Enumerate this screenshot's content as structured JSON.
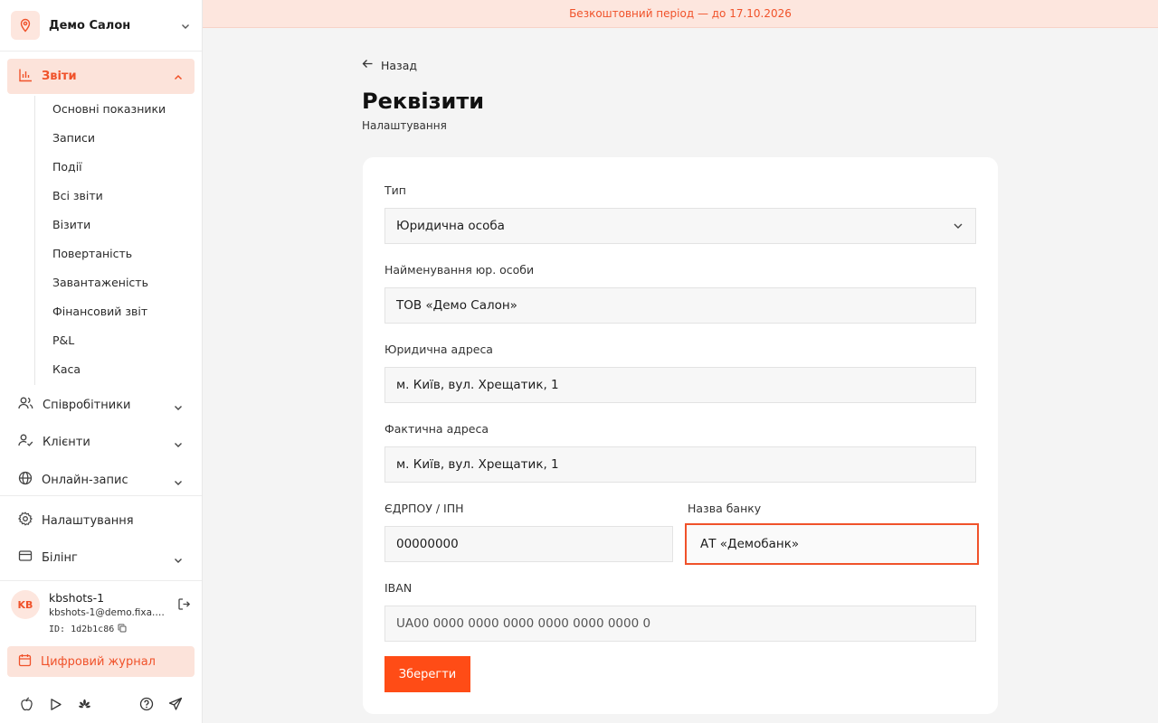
{
  "salon": {
    "name": "Демо Салон"
  },
  "nav": {
    "reports": {
      "label": "Звіти"
    },
    "reports_sub": [
      "Основні показники",
      "Записи",
      "Події",
      "Всі звіти",
      "Візити",
      "Повертаність",
      "Завантаженість",
      "Фінансовий звіт",
      "P&L",
      "Каса"
    ],
    "staff": "Співробітники",
    "clients": "Клієнти",
    "online": "Онлайн-запис",
    "settings": "Налаштування",
    "billing": "Білінг"
  },
  "user": {
    "initials": "KB",
    "name": "kbshots-1",
    "email": "kbshots-1@demo.fixa.b...",
    "id": "ID: 1d2b1c86"
  },
  "journal": {
    "label": "Цифровий журнал"
  },
  "banner": {
    "text": "Безкоштовний період — до 17.10.2026"
  },
  "page": {
    "back": "Назад",
    "title": "Реквізити",
    "subtitle": "Налаштування"
  },
  "form": {
    "type_label": "Тип",
    "type_value": "Юридична особа",
    "name_label": "Найменування юр. особи",
    "name_value": "ТОВ «Демо Салон»",
    "legal_addr_label": "Юридична адреса",
    "legal_addr_value": "м. Київ, вул. Хрещатик, 1",
    "actual_addr_label": "Фактична адреса",
    "actual_addr_value": "м. Київ, вул. Хрещатик, 1",
    "edrpou_label": "ЄДРПОУ / ІПН",
    "edrpou_value": "00000000",
    "bank_label": "Назва банку",
    "bank_value": "АТ «Демобанк»",
    "iban_label": "IBAN",
    "iban_value": "UA00 0000 0000 0000 0000 0000 0000 0",
    "save": "Зберегти"
  },
  "colors": {
    "accent": "#f0522a",
    "accent_light": "#fce3da",
    "button": "#ff4c16"
  }
}
